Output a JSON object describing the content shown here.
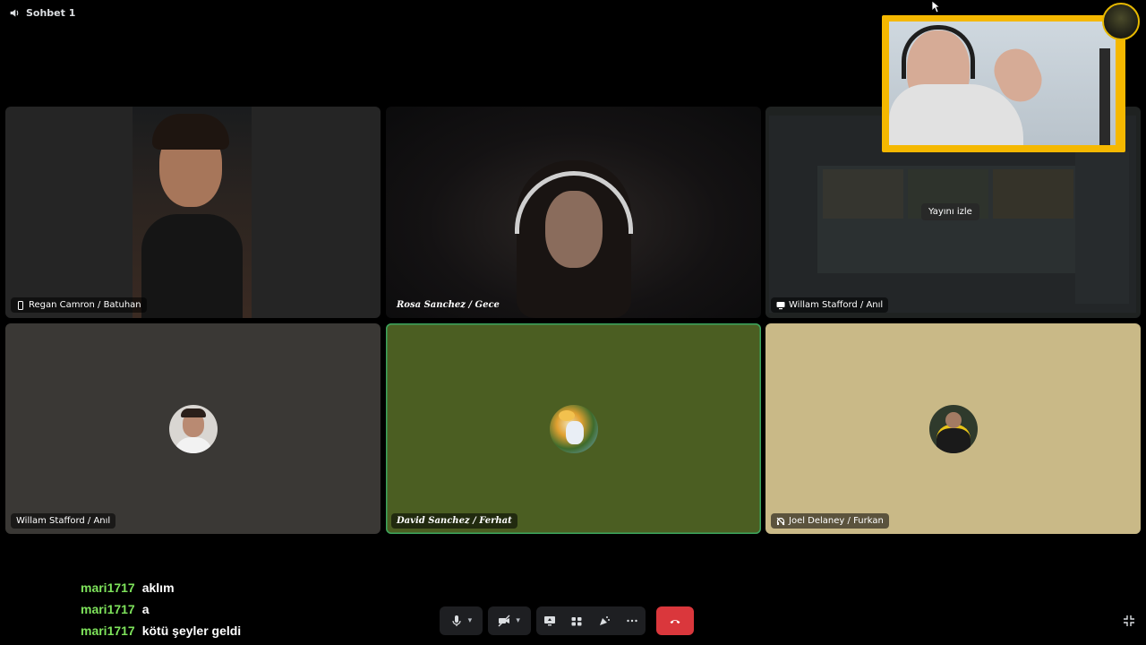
{
  "channel": {
    "name": "Sohbet 1",
    "icon": "speaker-icon"
  },
  "tiles": [
    {
      "name": "Regan Camron / Batuhan",
      "icon": "phone-icon"
    },
    {
      "name": "Rosa Sanchez / Gece"
    },
    {
      "name": "Willam Stafford / Anıl",
      "icon": "screen-share-icon",
      "overlay": "Yayını izle"
    },
    {
      "name": "Willam Stafford / Anıl"
    },
    {
      "name": "David Sanchez / Ferhat"
    },
    {
      "name": "Joel Delaney / Furkan",
      "icon": "deafened-icon"
    }
  ],
  "colors": {
    "tile_dark": "#3a3835",
    "tile_green": "#4b5e22",
    "tile_tan": "#c9b987",
    "speaking_border": "#3ba55d",
    "hangup": "#da373c",
    "chat_user": "#7ee35b",
    "facecam_frame": "#f5b800"
  },
  "chat": [
    {
      "user": "mari1717",
      "text": "aklım"
    },
    {
      "user": "mari1717",
      "text": "a"
    },
    {
      "user": "mari1717",
      "text": "kötü şeyler geldi"
    }
  ],
  "controls": [
    "microphone-icon",
    "camera-off-icon",
    "screen-share-icon",
    "activities-icon",
    "soundboard-icon",
    "more-icon",
    "hangup-icon",
    "fullscreen-exit-icon"
  ]
}
